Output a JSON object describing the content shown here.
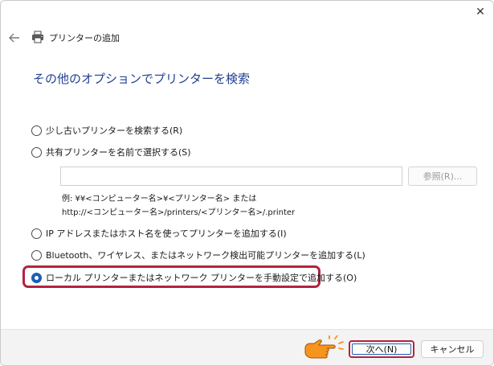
{
  "window": {
    "title": "プリンターの追加",
    "close_glyph": "✕"
  },
  "heading": "その他のオプションでプリンターを検索",
  "options": [
    {
      "label": "少し古いプリンターを検索する(R)",
      "checked": false
    },
    {
      "label": "共有プリンターを名前で選択する(S)",
      "checked": false
    },
    {
      "label": "IP アドレスまたはホスト名を使ってプリンターを追加する(I)",
      "checked": false
    },
    {
      "label": "Bluetooth、ワイヤレス、またはネットワーク検出可能プリンターを追加する(L)",
      "checked": false
    },
    {
      "label": "ローカル プリンターまたはネットワーク プリンターを手動設定で追加する(O)",
      "checked": true
    }
  ],
  "shared_printer": {
    "input_value": "",
    "browse_label": "参照(R)...",
    "example_line1": "例: ¥¥<コンピューター名>¥<プリンター名> または",
    "example_line2": "http://<コンピューター名>/printers/<プリンター名>/.printer"
  },
  "footer": {
    "next_label": "次へ(N)",
    "cancel_label": "キャンセル"
  },
  "colors": {
    "heading": "#1f3f8f",
    "accent": "#1a5fb4",
    "highlight": "#b3233e",
    "hand": "#f7941d"
  },
  "icons": {
    "back": "back-arrow-icon",
    "printer": "printer-icon",
    "close": "close-icon",
    "pointer": "pointing-hand-icon"
  }
}
